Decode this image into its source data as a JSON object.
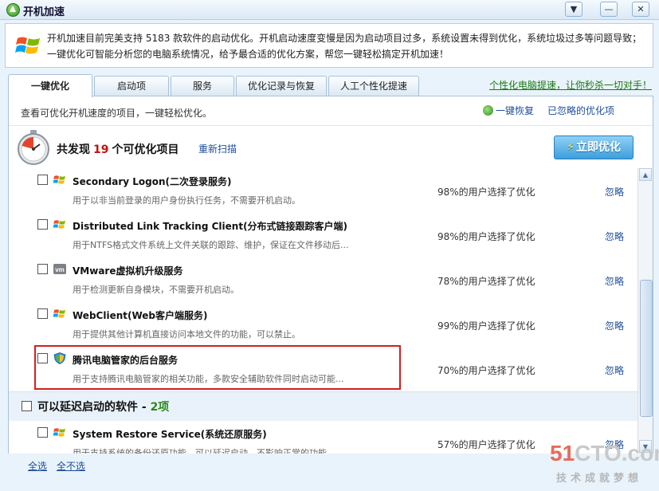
{
  "window": {
    "title": "开机加速",
    "buttons": {
      "dropdown": "▼",
      "minimize": "—",
      "close": "✕"
    }
  },
  "notice": {
    "line1": "开机加速目前完美支持 5183 款软件的启动优化。开机启动速度变慢是因为启动项目过多，系统设置未得到优化，系统垃圾过多等问题导致；",
    "line2": "一键优化可智能分析您的电脑系统情况，给予最合适的优化方案，帮您一键轻松搞定开机加速！"
  },
  "tabs": [
    {
      "label": "一键优化",
      "active": true
    },
    {
      "label": "启动项",
      "active": false
    },
    {
      "label": "服务",
      "active": false
    },
    {
      "label": "优化记录与恢复",
      "active": false
    },
    {
      "label": "人工个性化提速",
      "active": false
    }
  ],
  "promo_link": "个性化电脑提速，让你秒杀一切对手！",
  "subheader": {
    "description": "查看可优化开机速度的项目，一键轻松优化。",
    "restore_label": "一键恢复",
    "ignored_label": "已忽略的优化项"
  },
  "summary": {
    "prefix": "共发现",
    "count": "19",
    "suffix": "个可优化项目",
    "rescan": "重新扫描",
    "optimize_button": "立即优化"
  },
  "items": [
    {
      "name": "Secondary Logon(二次登录服务)",
      "desc": "用于以非当前登录的用户身份执行任务，不需要开机启动。",
      "pct": "98%的用户选择了优化",
      "ignore": "忽略",
      "icon": "windows-flag-icon"
    },
    {
      "name": "Distributed Link Tracking Client(分布式链接跟踪客户端)",
      "desc": "用于NTFS格式文件系统上文件关联的跟踪、维护，保证在文件移动后...",
      "pct": "98%的用户选择了优化",
      "ignore": "忽略",
      "icon": "windows-flag-icon"
    },
    {
      "name": "VMware虚拟机升级服务",
      "desc": "用于检测更新自身模块，不需要开机启动。",
      "pct": "78%的用户选择了优化",
      "ignore": "忽略",
      "icon": "vmware-icon"
    },
    {
      "name": "WebClient(Web客户端服务)",
      "desc": "用于提供其他计算机直接访问本地文件的功能，可以禁止。",
      "pct": "99%的用户选择了优化",
      "ignore": "忽略",
      "icon": "windows-flag-icon"
    },
    {
      "name": "腾讯电脑管家的后台服务",
      "desc": "用于支持腾讯电脑管家的相关功能，多款安全辅助软件同时启动可能...",
      "pct": "70%的用户选择了优化",
      "ignore": "忽略",
      "icon": "tencent-shield-icon"
    }
  ],
  "delay_section": {
    "title": "可以延迟启动的软件 - ",
    "count": "2项"
  },
  "delay_items": [
    {
      "name": "System Restore Service(系统还原服务)",
      "desc": "用于支持系统的备份还原功能，可以延迟启动，不影响正常的功能。",
      "pct": "57%的用户选择了优化",
      "ignore": "忽略",
      "icon": "windows-flag-icon"
    }
  ],
  "footer": {
    "select_all": "全选",
    "select_none": "全不选"
  },
  "watermark": {
    "brand_red": "51",
    "brand_gray": "CTO.com",
    "slogan": "技术成就梦想"
  },
  "colors": {
    "accent_blue": "#1d4d9a",
    "count_red": "#c21212",
    "promo_green": "#1b7a12",
    "highlight_red": "#d02020"
  }
}
